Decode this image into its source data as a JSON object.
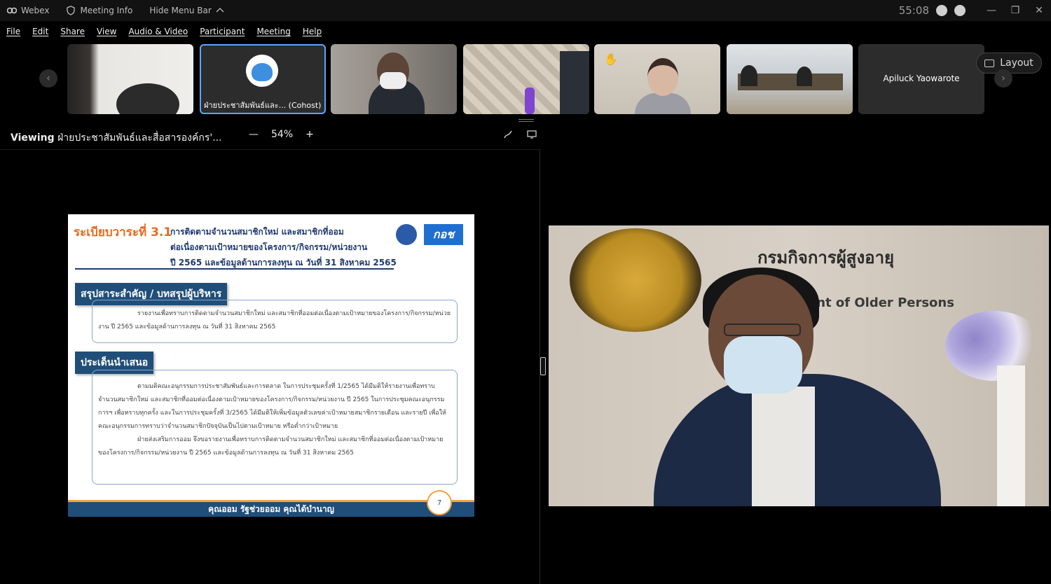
{
  "titlebar": {
    "app_name": "Webex",
    "meeting_info": "Meeting Info",
    "hide_menu": "Hide Menu Bar",
    "timer": "55:08"
  },
  "menu": {
    "items": [
      "File",
      "Edit",
      "Share",
      "View",
      "Audio & Video",
      "Participant",
      "Meeting",
      "Help"
    ]
  },
  "thumbnails": {
    "cohost_label": "ฝ่ายประชาสัมพันธ์และ... (Cohost)",
    "name_tile": "Apiluck Yaowarote",
    "layout_label": "Layout",
    "raised_hand": "✋"
  },
  "viewing": {
    "prefix": "Viewing",
    "source": "ฝ่ายประชาสัมพันธ์และสื่อสารองค์กร'...",
    "zoom": "54%"
  },
  "slide": {
    "title": "ระเบียบวาระที่ 3.1",
    "subtitle_1": "การติดตามจำนวนสมาชิกใหม่ และสมาชิกที่ออม",
    "subtitle_2": "ต่อเนื่องตามเป้าหมายของโครงการ/กิจกรรม/หน่วยงาน",
    "subtitle_3": "ปี 2565 และข้อมูลด้านการลงทุน ณ วันที่ 31 สิงหาคม 2565",
    "logo_text": "กอช",
    "section1": "สรุปสาระสำคัญ / บทสรุปผู้บริหาร",
    "box1_text": "รายงานเพื่อทราบการติดตามจำนวนสมาชิกใหม่ และสมาชิกที่ออมต่อเนื่องตามเป้าหมายของโครงการ/กิจกรรม/หน่วยงาน ปี 2565 และข้อมูลด้านการลงทุน ณ วันที่ 31 สิงหาคม 2565",
    "section2": "ประเด็นนำเสนอ",
    "box2_p1": "ตามมติคณะอนุกรรมการประชาสัมพันธ์และการตลาด ในการประชุมครั้งที่ 1/2565 ได้มีมติให้รายงานเพื่อทราบจำนวนสมาชิกใหม่ และสมาชิกที่ออมต่อเนื่องตามเป้าหมายของโครงการ/กิจกรรม/หน่วยงาน ปี 2565 ในการประชุมคณะอนุกรรมการฯ เพื่อทราบทุกครั้ง และในการประชุมครั้งที่ 3/2565 ได้มีมติให้เพิ่มข้อมูลตัวเลขค่าเป้าหมายสมาชิกรายเดือน และรายปี เพื่อให้คณะอนุกรรมการทราบว่าจำนวนสมาชิกปัจจุบันเป็นไปตามเป้าหมาย หรือต่ำกว่าเป้าหมาย",
    "box2_p2": "ฝ่ายส่งเสริมการออม จึงขอรายงานเพื่อทราบการติดตามจำนวนสมาชิกใหม่ และสมาชิกที่ออมต่อเนื่องตามเป้าหมายของโครงการ/กิจกรรม/หน่วยงาน ปี 2565 และข้อมูลด้านการลงทุน ณ วันที่ 31 สิงหาคม 2565",
    "footer": "คุณออม รัฐช่วยออม คุณได้บำนาญ",
    "page_number": "7"
  },
  "video": {
    "agency_name": "กรมกิจการผู้สูงอายุ",
    "agency_english": "ent of Older Persons"
  }
}
